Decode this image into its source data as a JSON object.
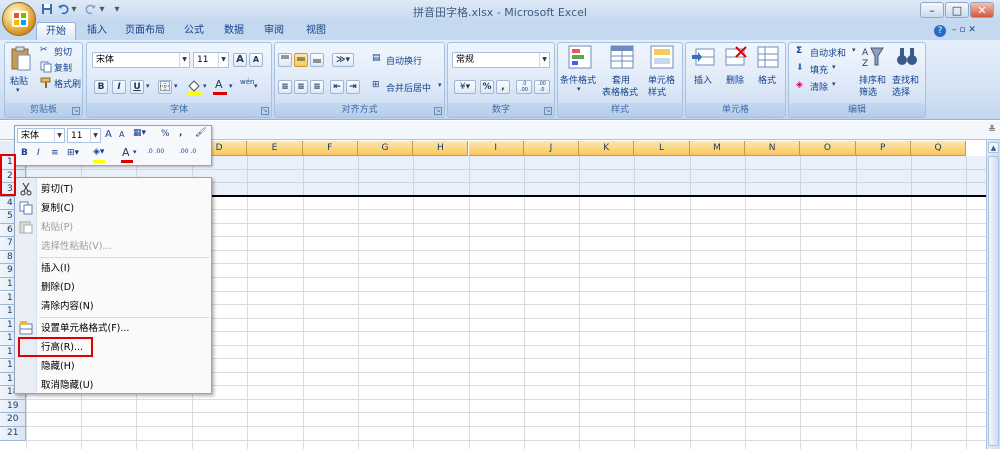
{
  "window": {
    "title": "拼音田字格.xlsx - Microsoft Excel",
    "help": "?",
    "minimize": "–",
    "restore": "□",
    "close": "✕"
  },
  "quick_access": {
    "save_icon": "save-icon",
    "undo_icon": "undo-icon",
    "redo_icon": "redo-icon",
    "customize": "▾"
  },
  "tabs": [
    "开始",
    "插入",
    "页面布局",
    "公式",
    "数据",
    "审阅",
    "视图"
  ],
  "active_tab": "开始",
  "ribbon": {
    "clipboard": {
      "label": "剪贴板",
      "paste": "粘贴",
      "cut": "剪切",
      "copy": "复制",
      "format_painter": "格式刷"
    },
    "font": {
      "label": "字体",
      "font_name": "宋体",
      "font_size": "11",
      "grow": "A",
      "shrink": "A",
      "bold": "B",
      "italic": "I",
      "underline": "U",
      "phonetic": "wén",
      "font_color_accent": "#e00000",
      "fill_color_accent": "#ffff00"
    },
    "alignment": {
      "label": "对齐方式",
      "wrap_text": "自动换行",
      "merge_center": "合并后居中"
    },
    "number": {
      "label": "数字",
      "format": "常规",
      "percent": "%",
      "comma": ",",
      "inc_decimal": ".0 .00",
      "dec_decimal": ".00 .0"
    },
    "styles": {
      "label": "样式",
      "conditional": "条件格式",
      "format_table_1": "套用",
      "format_table_2": "表格格式",
      "cell_styles_1": "单元格",
      "cell_styles_2": "样式"
    },
    "cells": {
      "label": "单元格",
      "insert": "插入",
      "delete": "删除",
      "format": "格式"
    },
    "editing": {
      "label": "编辑",
      "autosum": "自动求和",
      "fill": "填充",
      "clear": "清除",
      "sort_1": "排序和",
      "sort_2": "筛选",
      "find_1": "查找和",
      "find_2": "选择"
    }
  },
  "sheet": {
    "columns": [
      "D",
      "E",
      "F",
      "G",
      "H",
      "I",
      "J",
      "K",
      "L",
      "M",
      "N",
      "O",
      "P",
      "Q"
    ],
    "rows": [
      "1",
      "2",
      "3",
      "4",
      "5",
      "6",
      "7",
      "8",
      "9",
      "1",
      "1",
      "1",
      "1",
      "1",
      "1",
      "1",
      "1",
      "18",
      "19",
      "20",
      "21"
    ],
    "header_accent": "#f9c65a"
  },
  "mini_toolbar": {
    "font_name": "宋体",
    "font_size": "11",
    "bold": "B",
    "italic": "I",
    "percent": "%",
    "comma": ","
  },
  "context_menu": {
    "items": [
      {
        "label": "剪切(T)",
        "enabled": true
      },
      {
        "label": "复制(C)",
        "enabled": true
      },
      {
        "label": "粘贴(P)",
        "enabled": false
      },
      {
        "label": "选择性粘贴(V)...",
        "enabled": false
      },
      {
        "label": "插入(I)",
        "enabled": true
      },
      {
        "label": "删除(D)",
        "enabled": true
      },
      {
        "label": "清除内容(N)",
        "enabled": true
      },
      {
        "label": "设置单元格格式(F)...",
        "enabled": true
      },
      {
        "label": "行高(R)...",
        "enabled": true
      },
      {
        "label": "隐藏(H)",
        "enabled": true
      },
      {
        "label": "取消隐藏(U)",
        "enabled": true
      }
    ],
    "highlight_color": "#e00000"
  }
}
